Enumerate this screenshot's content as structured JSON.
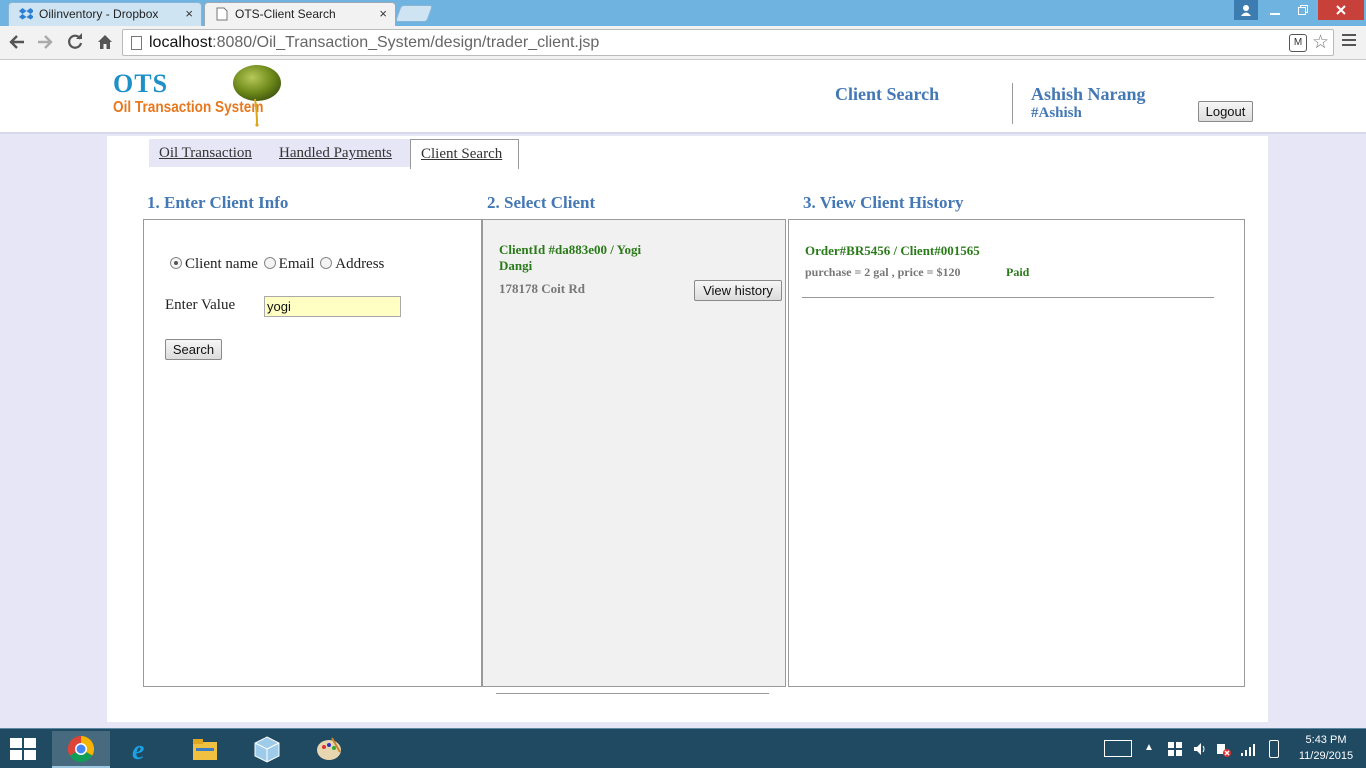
{
  "browser": {
    "tabs": [
      {
        "title": "Oilinventory - Dropbox",
        "close": "×"
      },
      {
        "title": "OTS-Client Search",
        "close": "×"
      }
    ],
    "url_host": "localhost",
    "url_rest": ":8080/Oil_Transaction_System/design/trader_client.jsp"
  },
  "header": {
    "logo_title": "OTS",
    "logo_subtitle": "Oil Transaction System",
    "page_title": "Client Search",
    "user_name": "Ashish Narang",
    "user_handle": "#Ashish",
    "logout_label": "Logout"
  },
  "nav_tabs": [
    {
      "label": "Oil Transaction"
    },
    {
      "label": "Handled Payments"
    },
    {
      "label": "Client Search"
    }
  ],
  "sections": {
    "enter": "1. Enter Client Info",
    "select": "2. Select Client",
    "history": "3. View Client History"
  },
  "search_form": {
    "radio_options": [
      "Client name",
      "Email",
      "Address"
    ],
    "selected": "Client name",
    "value_label": "Enter Value",
    "value": "yogi",
    "search_label": "Search"
  },
  "client_result": {
    "id_line": "ClientId #da883e00 / Yogi Dangi",
    "address": "178178 Coit Rd",
    "history_button": "View history"
  },
  "history": {
    "order_line": "Order#BR5456 / Client#001565",
    "purchase_line": "purchase = 2 gal , price = $120",
    "status": "Paid"
  },
  "taskbar": {
    "time": "5:43 PM",
    "date": "11/29/2015"
  },
  "colors": {
    "accent_blue": "#4478b4",
    "green_text": "#2a7a1a",
    "page_bg": "#e6e6f7"
  }
}
